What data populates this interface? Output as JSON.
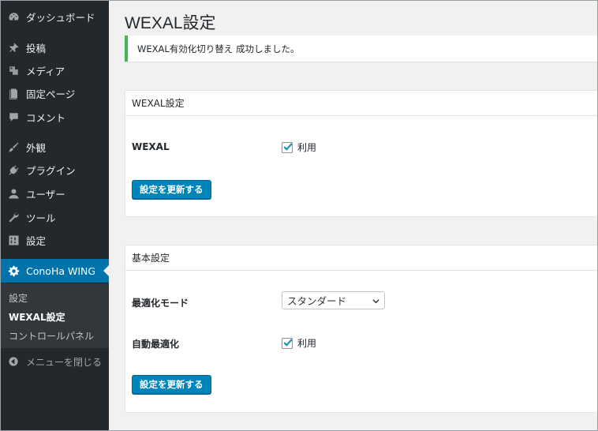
{
  "sidebar": {
    "items": [
      {
        "label": "ダッシュボード",
        "icon": "dashboard-icon"
      },
      {
        "label": "投稿",
        "icon": "pin-icon"
      },
      {
        "label": "メディア",
        "icon": "media-icon"
      },
      {
        "label": "固定ページ",
        "icon": "page-icon"
      },
      {
        "label": "コメント",
        "icon": "comment-icon"
      },
      {
        "label": "外観",
        "icon": "brush-icon"
      },
      {
        "label": "プラグイン",
        "icon": "plugin-icon"
      },
      {
        "label": "ユーザー",
        "icon": "user-icon"
      },
      {
        "label": "ツール",
        "icon": "wrench-icon"
      },
      {
        "label": "設定",
        "icon": "settings-icon"
      },
      {
        "label": "ConoHa WING",
        "icon": "gear-icon",
        "active": true
      }
    ],
    "submenu": [
      "設定",
      "WEXAL設定",
      "コントロールパネル"
    ],
    "collapse_label": "メニューを閉じる"
  },
  "page": {
    "title": "WEXAL設定",
    "notice": "WEXAL有効化切り替え 成功しました。"
  },
  "panel_wexal": {
    "heading": "WEXAL設定",
    "field_label": "WEXAL",
    "checkbox_label": "利用",
    "checked": true,
    "button": "設定を更新する"
  },
  "panel_basic": {
    "heading": "基本設定",
    "mode_label": "最適化モード",
    "mode_value": "スタンダード",
    "auto_label": "自動最適化",
    "auto_checkbox_label": "利用",
    "auto_checked": true,
    "button": "設定を更新する"
  },
  "colors": {
    "sidebar_bg": "#23282d",
    "active_bg": "#0073aa",
    "button_bg": "#0085ba",
    "notice_success": "#46b450"
  }
}
